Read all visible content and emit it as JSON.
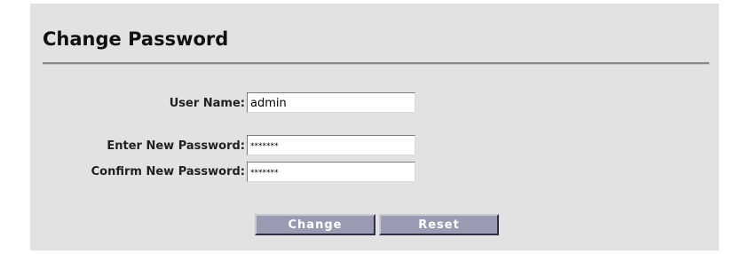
{
  "page": {
    "title": "Change Password"
  },
  "form": {
    "username_label": "User Name:",
    "username_value": "admin",
    "new_password_label": "Enter New Password:",
    "new_password_value": "*******",
    "confirm_password_label": "Confirm New Password:",
    "confirm_password_value": "*******"
  },
  "buttons": {
    "change_label": "Change",
    "reset_label": "Reset"
  }
}
